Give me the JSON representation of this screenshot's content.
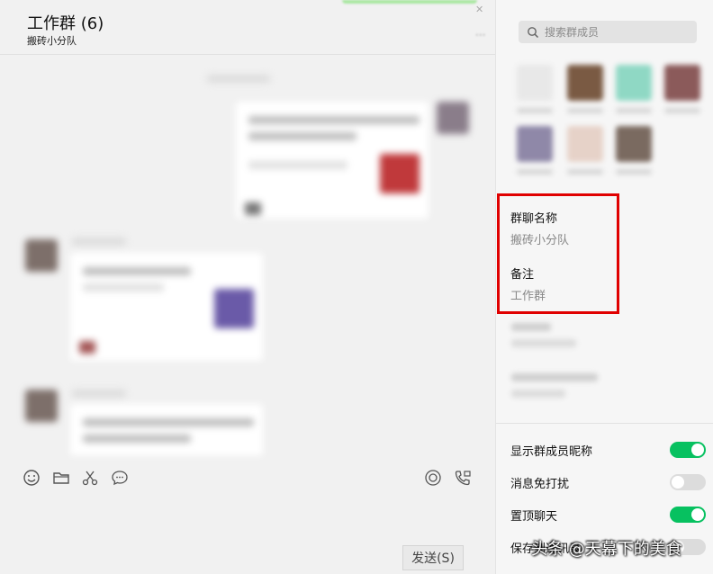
{
  "chat": {
    "title": "工作群 (6)",
    "subtitle": "搬砖小分队",
    "send_label": "发送(S)"
  },
  "toolbar": {
    "icons": [
      "emoji-icon",
      "folder-icon",
      "scissors-icon",
      "chat-bubble-icon",
      "voice-call-icon",
      "video-call-icon"
    ]
  },
  "panel": {
    "search_placeholder": "搜索群成员",
    "group_name_label": "群聊名称",
    "group_name_value": "搬砖小分队",
    "remark_label": "备注",
    "remark_value": "工作群",
    "toggles": [
      {
        "label": "显示群成员昵称",
        "on": true
      },
      {
        "label": "消息免打扰",
        "on": false
      },
      {
        "label": "置顶聊天",
        "on": true
      },
      {
        "label": "保存到通讯录",
        "on": false
      }
    ]
  },
  "watermark": "头条 @天幕下的美食",
  "colors": {
    "accent_green": "#07c160",
    "highlight_red": "#e00000"
  }
}
